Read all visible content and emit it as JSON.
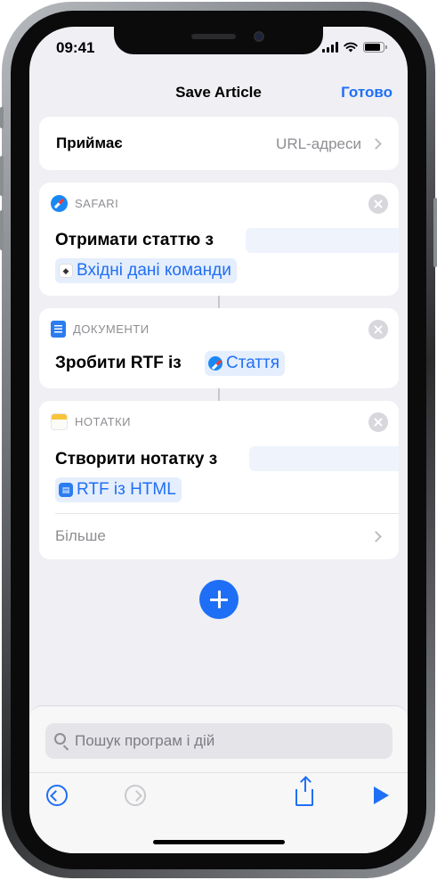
{
  "status_bar": {
    "time": "09:41"
  },
  "nav": {
    "title": "Save Article",
    "done_label": "Готово"
  },
  "receives": {
    "label": "Приймає",
    "value": "URL-адреси"
  },
  "actions": [
    {
      "app": "SAFARI",
      "app_icon": "safari-icon",
      "text": "Отримати статтю з",
      "token": {
        "label": "Вхідні дані команди",
        "icon": "shortcut-input-icon"
      }
    },
    {
      "app": "ДОКУМЕНТИ",
      "app_icon": "documents-icon",
      "text": "Зробити RTF із",
      "token": {
        "label": "Стаття",
        "icon": "safari-icon"
      }
    },
    {
      "app": "НОТАТКИ",
      "app_icon": "notes-icon",
      "text": "Створити нотатку з",
      "token": {
        "label": "RTF із HTML",
        "icon": "documents-icon"
      },
      "more_label": "Більше"
    }
  ],
  "search": {
    "placeholder": "Пошук програм і дій",
    "value": ""
  },
  "toolbar": {
    "undo": "undo-icon",
    "redo": "redo-icon",
    "share": "share-icon",
    "run": "play-icon"
  },
  "colors": {
    "accent": "#1f6ff6",
    "background": "#efeff4",
    "secondary_text": "#8e8e93"
  }
}
